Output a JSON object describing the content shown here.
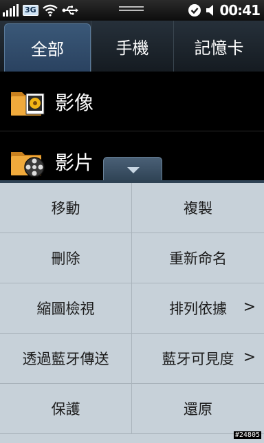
{
  "status_bar": {
    "network": "3G",
    "time": "00:41",
    "icons": [
      "signal-icon",
      "network-3g-icon",
      "wifi-icon",
      "usb-icon",
      "notification-handle-icon",
      "alarm-clock-icon",
      "volume-icon"
    ]
  },
  "tabs": [
    {
      "label": "全部",
      "selected": true
    },
    {
      "label": "手機",
      "selected": false
    },
    {
      "label": "記憶卡",
      "selected": false
    }
  ],
  "list": [
    {
      "label": "影像",
      "icon": "image-folder-icon"
    },
    {
      "label": "影片",
      "icon": "video-folder-icon"
    }
  ],
  "menu": {
    "toggle_icon": "chevron-down-icon",
    "items": [
      {
        "label": "移動",
        "submenu": false
      },
      {
        "label": "複製",
        "submenu": false
      },
      {
        "label": "刪除",
        "submenu": false
      },
      {
        "label": "重新命名",
        "submenu": false
      },
      {
        "label": "縮圖檢視",
        "submenu": false
      },
      {
        "label": "排列依據",
        "submenu": true
      },
      {
        "label": "透過藍牙傳送",
        "submenu": false
      },
      {
        "label": "藍牙可見度",
        "submenu": true
      },
      {
        "label": "保護",
        "submenu": false
      },
      {
        "label": "還原",
        "submenu": false
      }
    ],
    "submenu_glyph": ">"
  },
  "watermark": "#24805",
  "colors": {
    "tab_selected": "#3a5878",
    "menu_bg": "#c7d1d9",
    "folder": "#e8a23a"
  }
}
